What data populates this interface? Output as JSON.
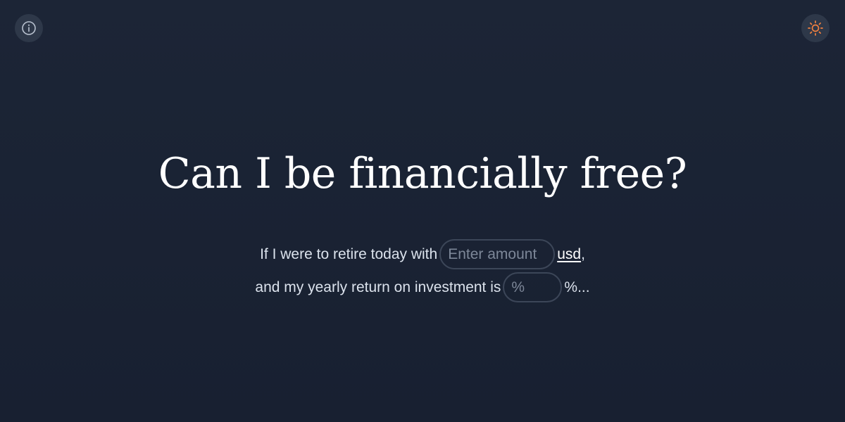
{
  "header": {
    "info_icon": "info-icon",
    "theme_icon": "sun-icon",
    "theme_icon_color": "#f4813f"
  },
  "main": {
    "title": "Can I be financially free?",
    "line1": {
      "prefix": "If I were to retire today with",
      "amount_placeholder": "Enter amount",
      "amount_value": "",
      "currency_link": "usd",
      "suffix": ","
    },
    "line2": {
      "prefix": "and my yearly return on investment is",
      "percent_placeholder": "%",
      "percent_value": "",
      "suffix": "%..."
    }
  },
  "colors": {
    "background": "#1b2334",
    "icon_button_bg": "#2e3849",
    "input_border": "#3c4658"
  }
}
